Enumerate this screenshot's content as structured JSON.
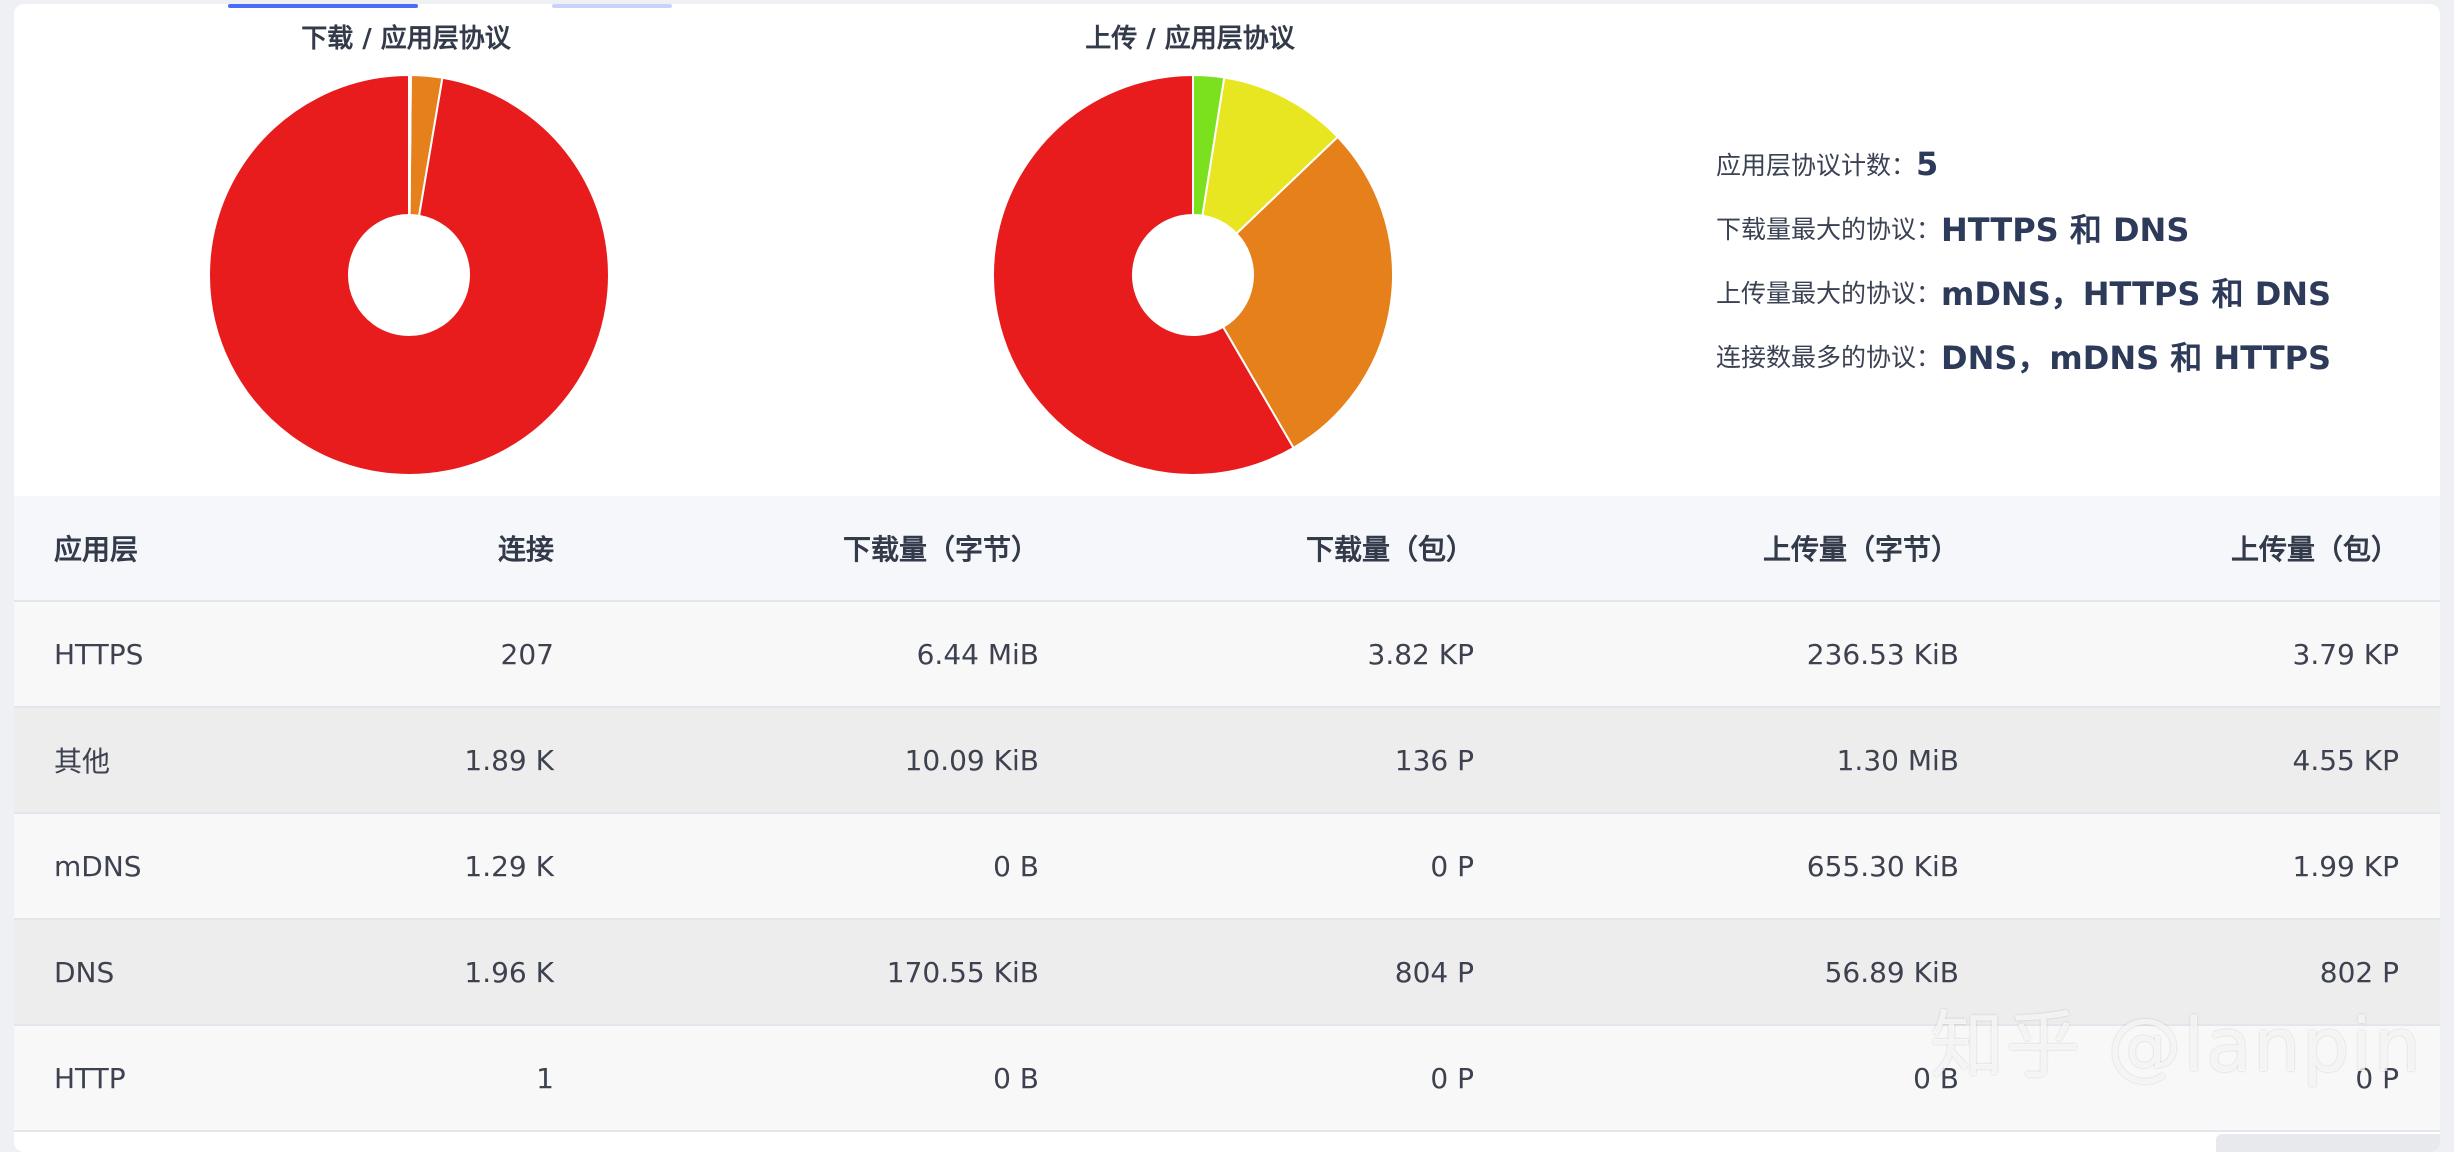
{
  "charts": [
    {
      "title": "下载 / 应用层协议",
      "chart_data": {
        "type": "pie",
        "title": "下载 / 应用层协议",
        "categories": [
          "HTTPS",
          "DNS",
          "其他",
          "mDNS",
          "HTTP"
        ],
        "values": [
          6594.56,
          170.55,
          10.09,
          0,
          0
        ],
        "unit": "KiB",
        "colors": [
          "#e81c1c",
          "#e5801b",
          "#e8e620",
          "#7be01e",
          "#2ec4b6"
        ]
      }
    },
    {
      "title": "上传 / 应用层协议",
      "chart_data": {
        "type": "pie",
        "title": "上传 / 应用层协议",
        "categories": [
          "其他",
          "mDNS",
          "HTTPS",
          "DNS",
          "HTTP"
        ],
        "values": [
          1331.2,
          655.3,
          236.53,
          56.89,
          0
        ],
        "unit": "KiB",
        "colors": [
          "#e81c1c",
          "#e5801b",
          "#e8e620",
          "#7be01e",
          "#2ec4b6"
        ]
      }
    }
  ],
  "summary": [
    {
      "label": "应用层协议计数：",
      "value": "5"
    },
    {
      "label": "下载量最大的协议：",
      "value": "HTTPS 和 DNS"
    },
    {
      "label": "上传量最大的协议：",
      "value": "mDNS，HTTPS 和 DNS"
    },
    {
      "label": "连接数最多的协议：",
      "value": "DNS，mDNS 和 HTTPS"
    }
  ],
  "table": {
    "headers": [
      "应用层",
      "连接",
      "下载量（字节）",
      "下载量（包）",
      "上传量（字节）",
      "上传量（包）"
    ],
    "rows": [
      [
        "HTTPS",
        "207",
        "6.44 MiB",
        "3.82 KP",
        "236.53 KiB",
        "3.79 KP"
      ],
      [
        "其他",
        "1.89 K",
        "10.09 KiB",
        "136 P",
        "1.30 MiB",
        "4.55 KP"
      ],
      [
        "mDNS",
        "1.29 K",
        "0 B",
        "0 P",
        "655.30 KiB",
        "1.99 KP"
      ],
      [
        "DNS",
        "1.96 K",
        "170.55 KiB",
        "804 P",
        "56.89 KiB",
        "802 P"
      ],
      [
        "HTTP",
        "1",
        "0 B",
        "0 P",
        "0 B",
        "0 P"
      ]
    ]
  },
  "watermark": "知乎 @lanpin",
  "colors": {
    "accent_tab": "#4a6cf7",
    "tab_inactive": "#c9d3f7"
  }
}
